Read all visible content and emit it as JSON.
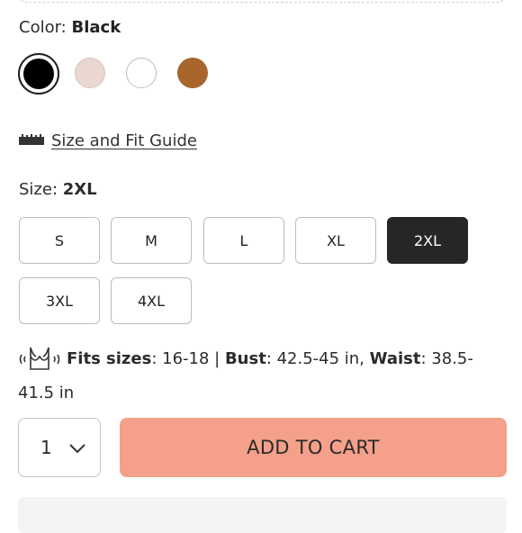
{
  "color": {
    "label": "Color:",
    "selected_name": "Black",
    "swatches": [
      {
        "name": "black",
        "hex": "#000000",
        "selected": true
      },
      {
        "name": "nude",
        "hex": "#ead7cf",
        "selected": false
      },
      {
        "name": "white",
        "hex": "#ffffff",
        "selected": false
      },
      {
        "name": "brown",
        "hex": "#a8652c",
        "selected": false
      }
    ]
  },
  "guide": {
    "icon": "ruler-icon",
    "link_text": "Size and Fit Guide"
  },
  "size": {
    "label": "Size:",
    "selected": "2XL",
    "options": [
      "S",
      "M",
      "L",
      "XL",
      "2XL",
      "3XL",
      "4XL"
    ]
  },
  "fit_info": {
    "icon": "bra-vibration-icon",
    "fits_label": "Fits sizes",
    "fits_value": ": 16-18 | ",
    "bust_label": "Bust",
    "bust_value": ": 42.5-45 in, ",
    "waist_label": "Waist",
    "waist_value": ": 38.5-41.5 in"
  },
  "quantity": {
    "value": "1"
  },
  "cart": {
    "button_label": "ADD TO CART",
    "color": "#f4a08a"
  }
}
